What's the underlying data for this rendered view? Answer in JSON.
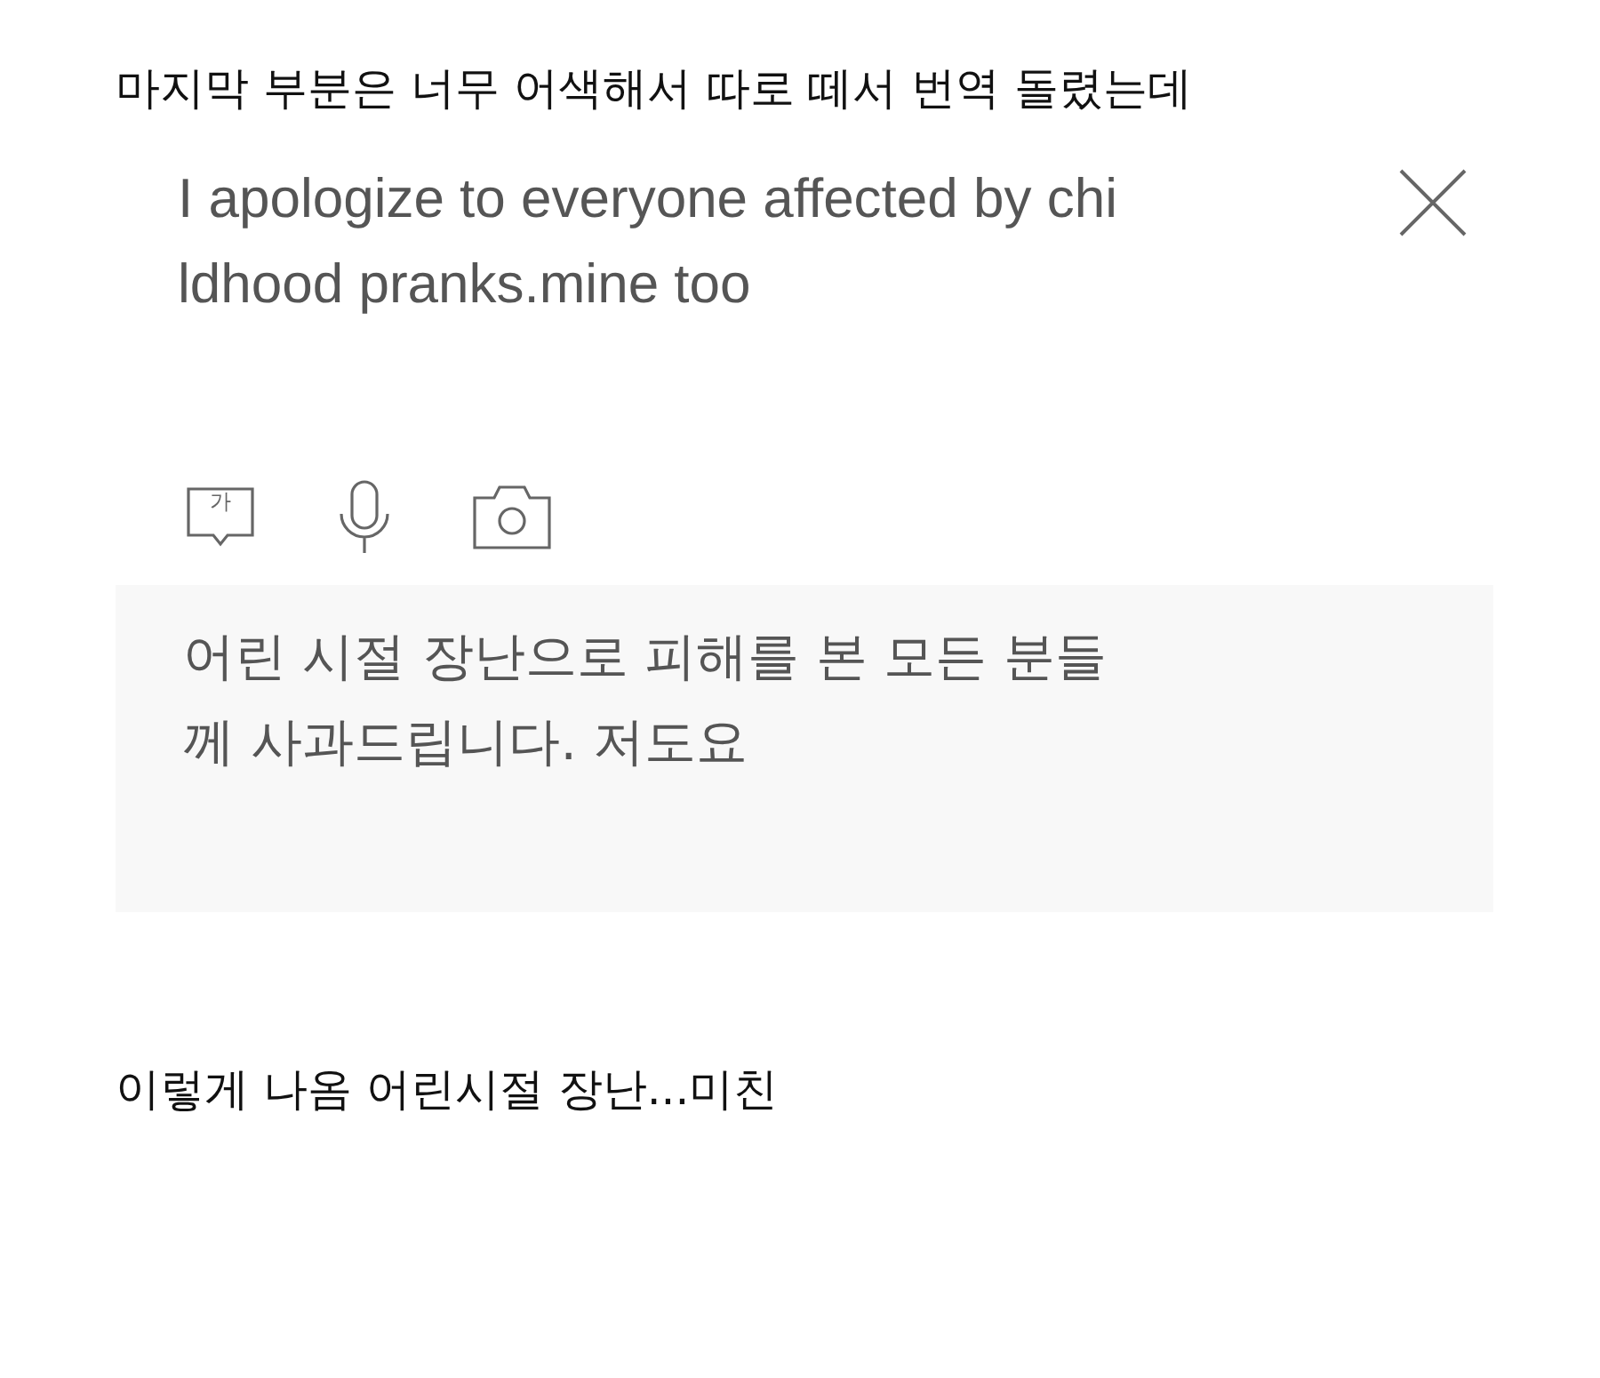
{
  "caption_top": "마지막 부분은 너무 어색해서 따로 떼서 번역 돌렸는데",
  "translator": {
    "source_lines": [
      "I apologize to everyone affected by chi",
      "ldhood pranks.mine too"
    ],
    "tools": [
      {
        "kind": "handwriting",
        "glyph": "가"
      },
      {
        "kind": "voice"
      },
      {
        "kind": "camera"
      }
    ],
    "result_lines": [
      "어린 시절 장난으로 피해를 본 모든 분들",
      "께 사과드립니다. 저도요"
    ]
  },
  "caption_bottom": "이렇게 나옴 어린시절 장난...미친"
}
